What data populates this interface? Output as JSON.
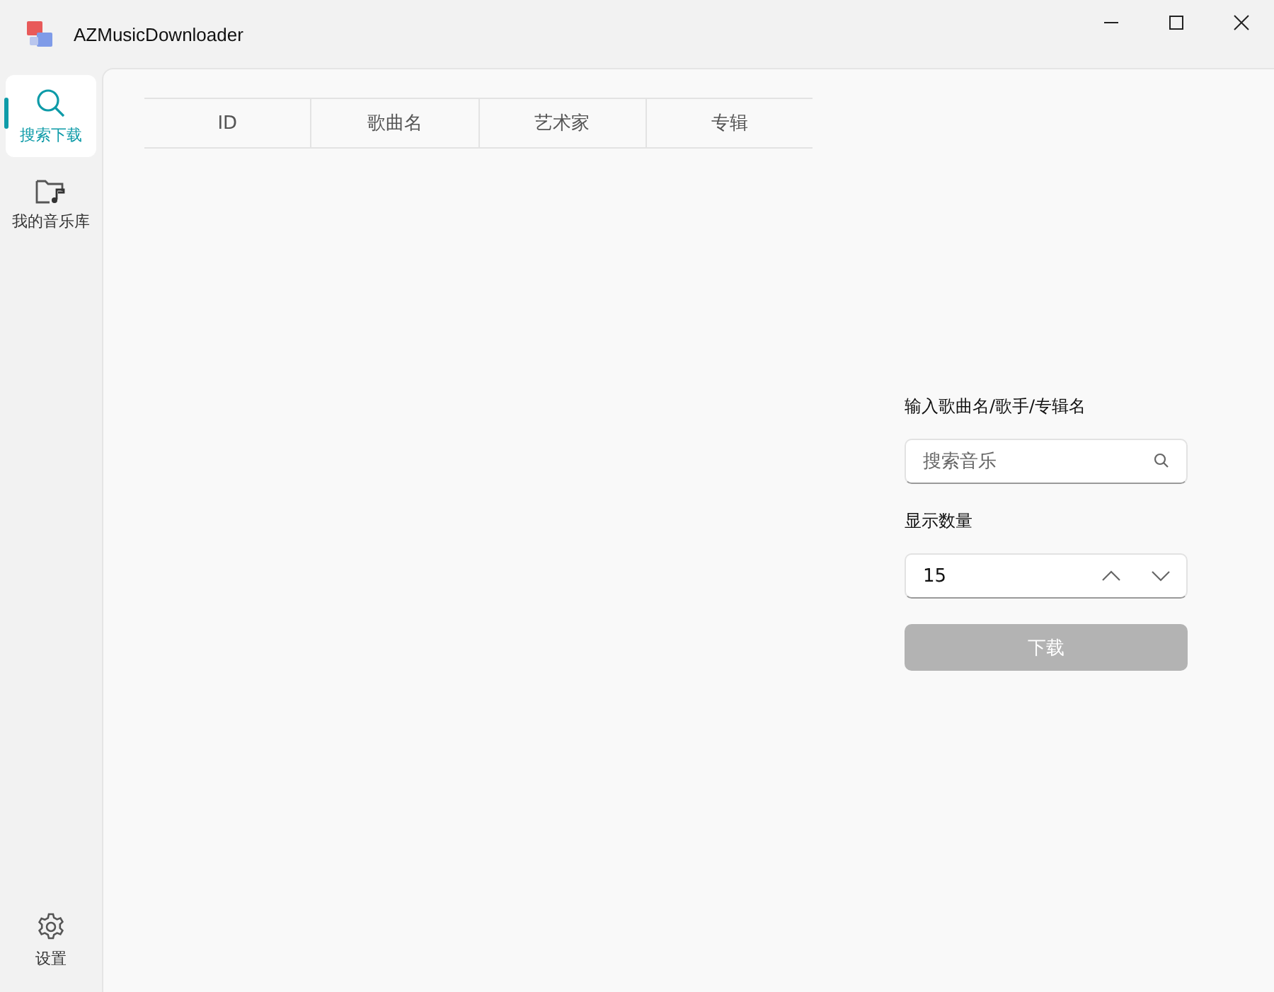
{
  "window": {
    "title": "AZMusicDownloader"
  },
  "sidebar": {
    "items": [
      {
        "label": "搜索下载",
        "kind": "search",
        "selected": true
      },
      {
        "label": "我的音乐库",
        "kind": "library",
        "selected": false
      }
    ],
    "footer": {
      "label": "设置",
      "kind": "settings"
    }
  },
  "table": {
    "columns": [
      "ID",
      "歌曲名",
      "艺术家",
      "专辑"
    ]
  },
  "form": {
    "query_label": "输入歌曲名/歌手/专辑名",
    "search": {
      "placeholder": "搜索音乐"
    },
    "count_label": "显示数量",
    "count": {
      "value": "15"
    },
    "download_button": {
      "label": "下载",
      "disabled": true
    }
  }
}
